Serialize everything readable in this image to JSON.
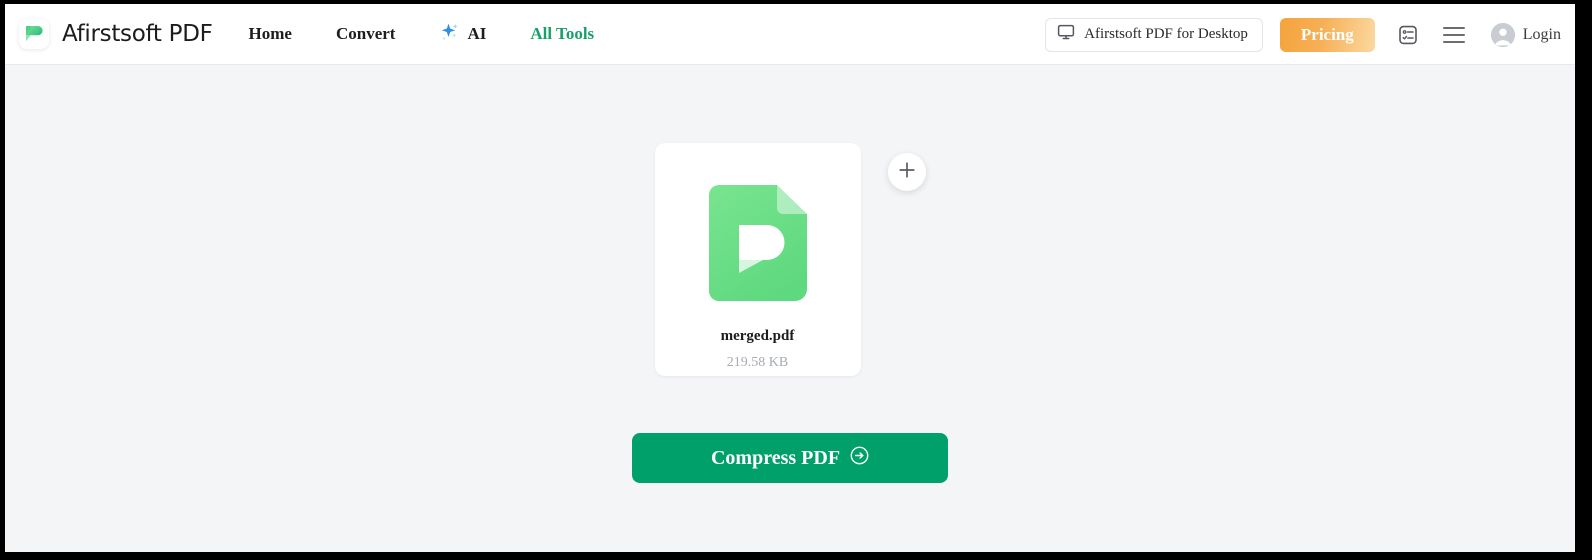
{
  "app": {
    "brand": "Afirstsoft PDF",
    "logo_icon": "afirstsoft-logo-icon"
  },
  "header": {
    "nav": [
      {
        "label": "Home",
        "name": "nav-home",
        "accent": false
      },
      {
        "label": "Convert",
        "name": "nav-convert",
        "accent": false
      },
      {
        "label": "AI",
        "name": "nav-ai",
        "accent": false,
        "icon": "sparkle-icon"
      },
      {
        "label": "All Tools",
        "name": "nav-all-tools",
        "accent": true
      }
    ],
    "desktop_button": {
      "label": "Afirstsoft PDF for Desktop",
      "icon": "monitor-icon"
    },
    "pricing_button": {
      "label": "Pricing"
    },
    "tasklist_icon": "task-list-icon",
    "menu_icon": "hamburger-menu-icon",
    "login": {
      "label": "Login",
      "avatar_icon": "user-avatar-icon"
    }
  },
  "main": {
    "file": {
      "name": "merged.pdf",
      "size": "219.58 KB",
      "icon": "pdf-file-icon"
    },
    "add_file_button": {
      "icon": "plus-icon",
      "label": ""
    },
    "primary_action": {
      "label": "Compress PDF",
      "icon": "arrow-right-circle-icon"
    }
  },
  "colors": {
    "brand_green": "#18a16b",
    "action_green": "#00a06a",
    "pricing_orange_start": "#f5a33c",
    "pricing_orange_end": "#fbd9a0",
    "file_icon_green": "#6ede87",
    "page_background": "#f4f5f7",
    "header_background": "#ffffff",
    "muted_text": "#a7abb3"
  }
}
